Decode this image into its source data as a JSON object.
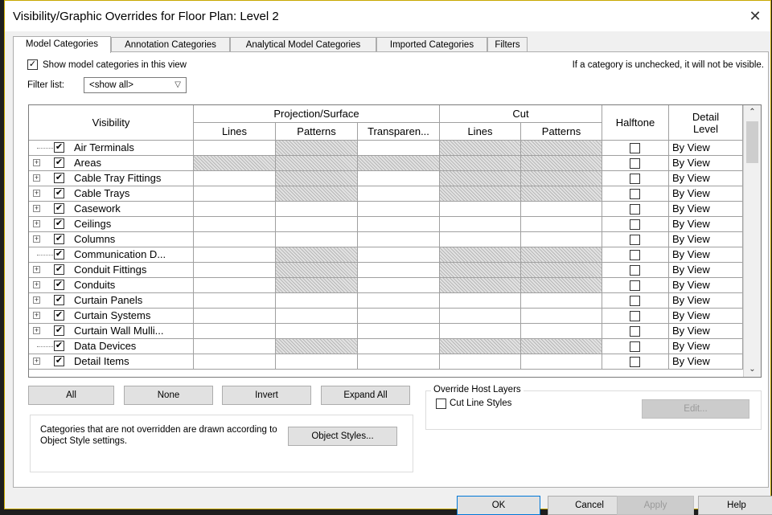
{
  "dialog": {
    "title": "Visibility/Graphic Overrides for Floor Plan: Level 2",
    "close_symbol": "✕"
  },
  "tabs": [
    {
      "label": "Model Categories",
      "active": true
    },
    {
      "label": "Annotation Categories",
      "active": false
    },
    {
      "label": "Analytical Model Categories",
      "active": false
    },
    {
      "label": "Imported Categories",
      "active": false
    },
    {
      "label": "Filters",
      "active": false
    }
  ],
  "show_model": {
    "label": "Show model categories in this view",
    "checked": true
  },
  "hint_text": "If a category is unchecked, it will not be visible.",
  "filter": {
    "label": "Filter list:",
    "value": "<show all>"
  },
  "table": {
    "headers": {
      "visibility": "Visibility",
      "projection": "Projection/Surface",
      "proj_lines": "Lines",
      "proj_patterns": "Patterns",
      "proj_transparency": "Transparen...",
      "cut": "Cut",
      "cut_lines": "Lines",
      "cut_patterns": "Patterns",
      "halftone": "Halftone",
      "detail_level": "Detail Level"
    },
    "rows": [
      {
        "name": "Air Terminals",
        "expandable": false,
        "checked": true,
        "hatch": [
          false,
          true,
          false,
          true,
          true
        ],
        "halftone": false,
        "detail": "By View"
      },
      {
        "name": "Areas",
        "expandable": true,
        "checked": true,
        "hatch": [
          true,
          true,
          true,
          true,
          true
        ],
        "halftone": false,
        "detail": "By View"
      },
      {
        "name": "Cable Tray Fittings",
        "expandable": true,
        "checked": true,
        "hatch": [
          false,
          true,
          false,
          true,
          true
        ],
        "halftone": false,
        "detail": "By View"
      },
      {
        "name": "Cable Trays",
        "expandable": true,
        "checked": true,
        "hatch": [
          false,
          true,
          false,
          true,
          true
        ],
        "halftone": false,
        "detail": "By View"
      },
      {
        "name": "Casework",
        "expandable": true,
        "checked": true,
        "hatch": [
          false,
          false,
          false,
          false,
          false
        ],
        "halftone": false,
        "detail": "By View"
      },
      {
        "name": "Ceilings",
        "expandable": true,
        "checked": true,
        "hatch": [
          false,
          false,
          false,
          false,
          false
        ],
        "halftone": false,
        "detail": "By View"
      },
      {
        "name": "Columns",
        "expandable": true,
        "checked": true,
        "hatch": [
          false,
          false,
          false,
          false,
          false
        ],
        "halftone": false,
        "detail": "By View"
      },
      {
        "name": "Communication D...",
        "expandable": false,
        "checked": true,
        "hatch": [
          false,
          true,
          false,
          true,
          true
        ],
        "halftone": false,
        "detail": "By View"
      },
      {
        "name": "Conduit Fittings",
        "expandable": true,
        "checked": true,
        "hatch": [
          false,
          true,
          false,
          true,
          true
        ],
        "halftone": false,
        "detail": "By View"
      },
      {
        "name": "Conduits",
        "expandable": true,
        "checked": true,
        "hatch": [
          false,
          true,
          false,
          true,
          true
        ],
        "halftone": false,
        "detail": "By View"
      },
      {
        "name": "Curtain Panels",
        "expandable": true,
        "checked": true,
        "hatch": [
          false,
          false,
          false,
          false,
          false
        ],
        "halftone": false,
        "detail": "By View"
      },
      {
        "name": "Curtain Systems",
        "expandable": true,
        "checked": true,
        "hatch": [
          false,
          false,
          false,
          false,
          false
        ],
        "halftone": false,
        "detail": "By View"
      },
      {
        "name": "Curtain Wall Mulli...",
        "expandable": true,
        "checked": true,
        "hatch": [
          false,
          false,
          false,
          false,
          false
        ],
        "halftone": false,
        "detail": "By View"
      },
      {
        "name": "Data Devices",
        "expandable": false,
        "checked": true,
        "hatch": [
          false,
          true,
          false,
          true,
          true
        ],
        "halftone": false,
        "detail": "By View"
      },
      {
        "name": "Detail Items",
        "expandable": true,
        "checked": true,
        "hatch": [
          false,
          false,
          false,
          false,
          false
        ],
        "halftone": false,
        "detail": "By View"
      }
    ]
  },
  "scroll": {
    "up": "⌃",
    "down": "⌄"
  },
  "buttons": {
    "all": "All",
    "none": "None",
    "invert": "Invert",
    "expand_all": "Expand All",
    "object_styles": "Object Styles...",
    "edit": "Edit...",
    "ok": "OK",
    "cancel": "Cancel",
    "apply": "Apply",
    "help": "Help"
  },
  "override_host": {
    "legend": "Override Host Layers",
    "cut_line_label": "Cut Line Styles",
    "checked": false
  },
  "note": "Categories that are not overridden are drawn according to Object Style settings."
}
